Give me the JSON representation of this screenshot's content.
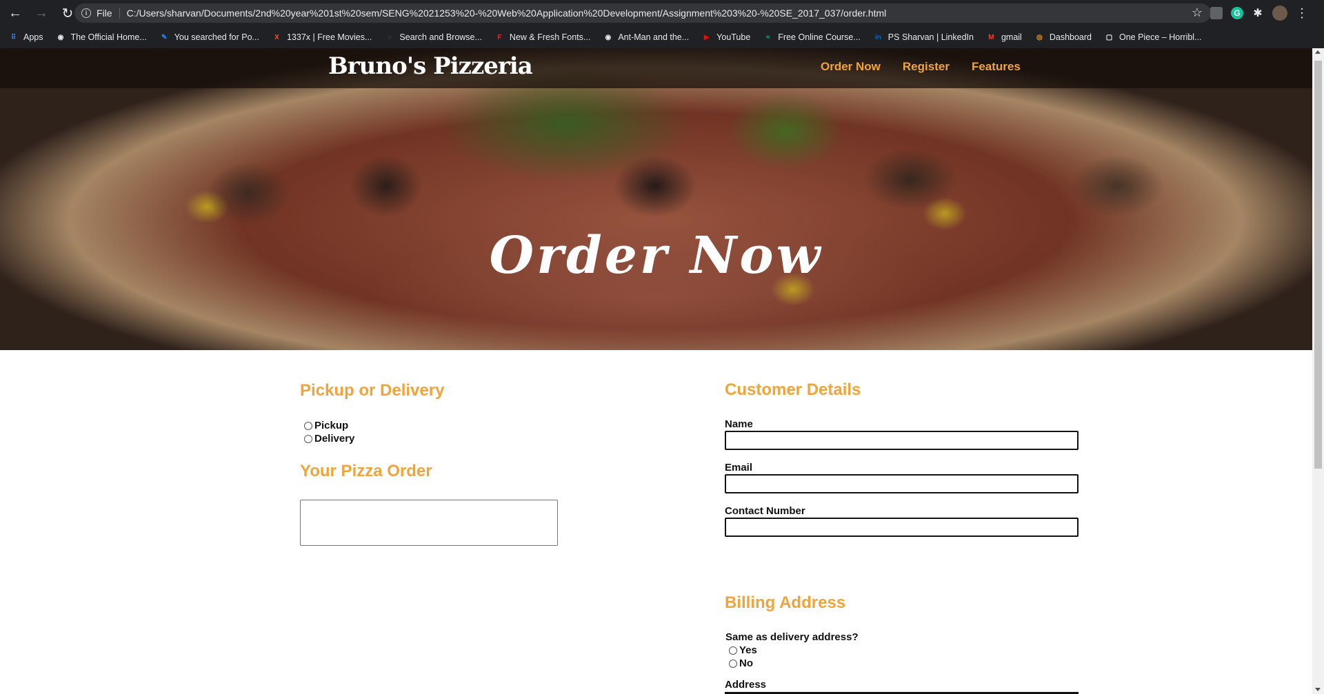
{
  "browser": {
    "file_label": "File",
    "url": "C:/Users/sharvan/Documents/2nd%20year%201st%20sem/SENG%2021253%20-%20Web%20Application%20Development/Assignment%203%20-%20SE_2017_037/order.html",
    "bookmarks": [
      {
        "label": "Apps",
        "icon": "apps-grid-icon",
        "color": "#4285f4"
      },
      {
        "label": "The Official Home...",
        "icon": "globe-icon",
        "color": "#e8eaed"
      },
      {
        "label": "You searched for Po...",
        "icon": "pen-icon",
        "color": "#1e88e5"
      },
      {
        "label": "1337x | Free Movies...",
        "icon": "x-logo-icon",
        "color": "#f4511e"
      },
      {
        "label": "Search and Browse...",
        "icon": "swirl-icon",
        "color": "#43a047"
      },
      {
        "label": "New & Fresh Fonts...",
        "icon": "f-logo-icon",
        "color": "#d32f2f"
      },
      {
        "label": "Ant-Man and the...",
        "icon": "globe-icon",
        "color": "#e8eaed"
      },
      {
        "label": "YouTube",
        "icon": "youtube-icon",
        "color": "#ff0000"
      },
      {
        "label": "Free Online Course...",
        "icon": "course-icon",
        "color": "#26a69a"
      },
      {
        "label": "PS Sharvan | LinkedIn",
        "icon": "linkedin-icon",
        "color": "#0a66c2"
      },
      {
        "label": "gmail",
        "icon": "gmail-icon",
        "color": "#ea4335"
      },
      {
        "label": "Dashboard",
        "icon": "dashboard-icon",
        "color": "#f9ab00"
      },
      {
        "label": "One Piece – Horribl...",
        "icon": "page-icon",
        "color": "#ffffff"
      }
    ]
  },
  "site": {
    "brand": "Bruno's Pizzeria",
    "nav": [
      "Order Now",
      "Register",
      "Features"
    ],
    "hero_title": "Order Now",
    "accent_color": "#f0a43a"
  },
  "order": {
    "pickup_heading": "Pickup or Delivery",
    "options": [
      "Pickup",
      "Delivery"
    ],
    "pizza_heading": "Your Pizza Order",
    "pizza_value": ""
  },
  "customer": {
    "heading": "Customer Details",
    "fields": [
      {
        "label": "Name",
        "value": ""
      },
      {
        "label": "Email",
        "value": ""
      },
      {
        "label": "Contact Number",
        "value": ""
      }
    ]
  },
  "billing": {
    "heading": "Billing Address",
    "question": "Same as delivery address?",
    "options": [
      "Yes",
      "No"
    ],
    "address_label": "Address"
  }
}
